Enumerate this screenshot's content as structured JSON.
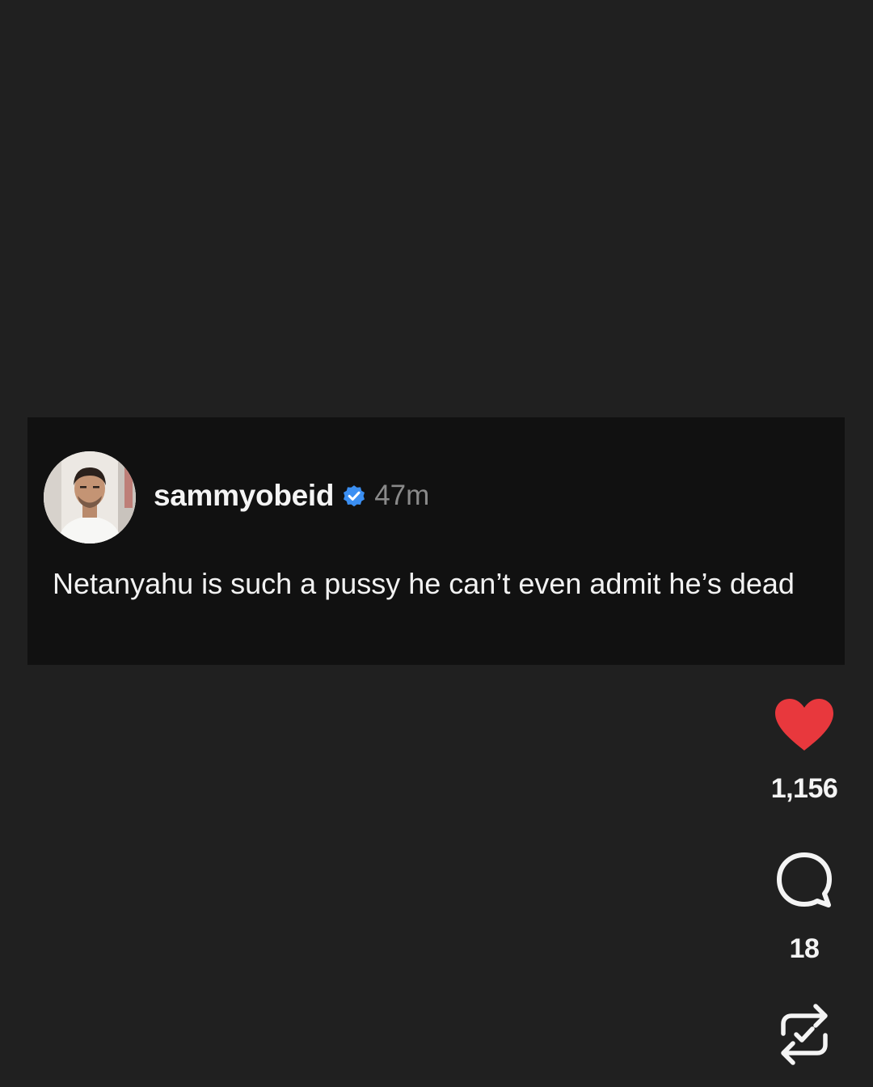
{
  "post": {
    "username": "sammyobeid",
    "verified_icon": "verified-badge-icon",
    "timestamp": "47m",
    "text": "Netanyahu is such a pussy he can’t even admit he’s dead"
  },
  "actions": {
    "likes": {
      "icon": "heart-icon",
      "count": "1,156",
      "color": "#e8383d"
    },
    "comments": {
      "icon": "comment-bubble-icon",
      "count": "18"
    },
    "repost": {
      "icon": "repost-check-icon"
    }
  },
  "colors": {
    "background": "#202020",
    "card": "#111111",
    "verified": "#3b8ff2",
    "timestamp": "#8a8a8a"
  }
}
